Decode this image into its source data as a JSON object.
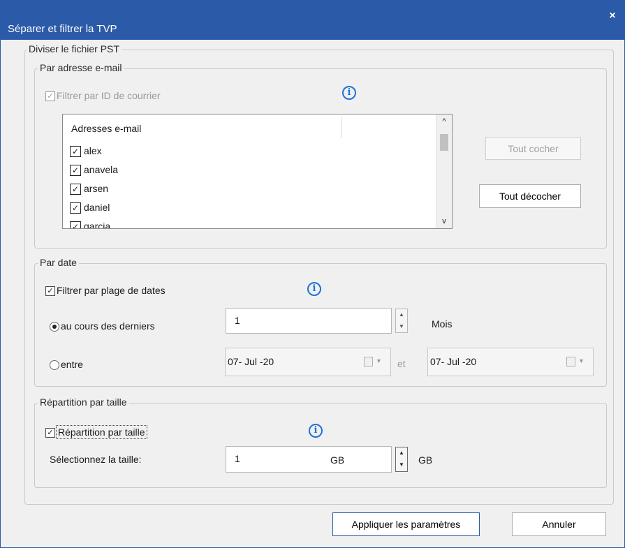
{
  "window": {
    "title": "Séparer et filtrer la TVP",
    "close_glyph": "×"
  },
  "main_group": {
    "legend": "Diviser le fichier PST"
  },
  "email_group": {
    "legend": "Par adresse e-mail",
    "filter_label": "Filtrer par ID de courrier",
    "filter_checked": true,
    "filter_enabled": false,
    "list_header": "Adresses e-mail",
    "items": [
      {
        "label": "alex",
        "checked": true
      },
      {
        "label": "anavela",
        "checked": true
      },
      {
        "label": "arsen",
        "checked": true
      },
      {
        "label": "daniel",
        "checked": true
      },
      {
        "label": "garcia",
        "checked": true
      }
    ],
    "check_all_label": "Tout cocher",
    "uncheck_all_label": "Tout décocher"
  },
  "date_group": {
    "legend": "Par date",
    "filter_label": "Filtrer par plage de dates",
    "filter_checked": true,
    "last_label": "au cours des derniers",
    "last_value": "1",
    "last_unit": "Mois",
    "between_label": "entre",
    "from_date": "07- Jul -20",
    "and_label": "et",
    "to_date": "07- Jul -20",
    "selected_option": "au cours des derniers"
  },
  "size_group": {
    "legend": "Répartition par taille",
    "filter_label": "Répartition par taille",
    "filter_checked": true,
    "select_label": "Sélectionnez la taille:",
    "size_value": "1",
    "size_unit_inner": "GB",
    "size_unit": "GB"
  },
  "footer": {
    "apply_label": "Appliquer les paramètres",
    "cancel_label": "Annuler"
  },
  "icons": {
    "info": "info-icon",
    "check": "✓",
    "up": "▲",
    "down": "▼",
    "caret_up": "^",
    "caret_down": "v"
  },
  "colors": {
    "titlebar": "#2b5aa8",
    "info": "#1d72d8",
    "dialog_bg": "#f0f0f0"
  }
}
